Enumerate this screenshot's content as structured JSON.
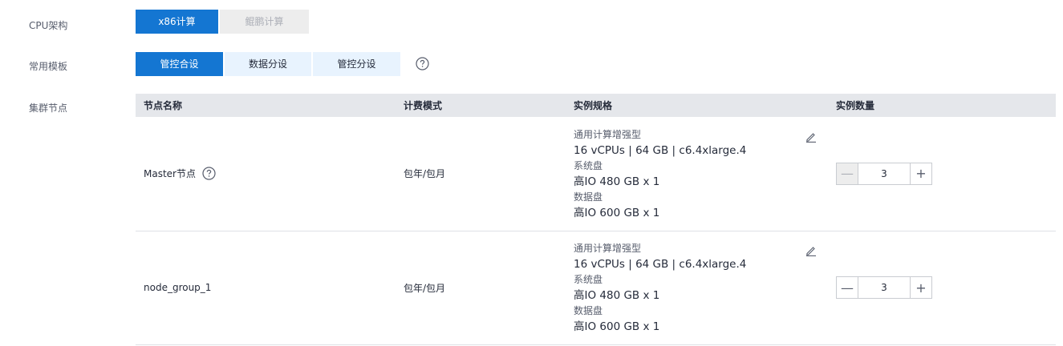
{
  "cpu_arch": {
    "label": "CPU架构",
    "options": [
      {
        "label": "x86计算",
        "state": "selected"
      },
      {
        "label": "鲲鹏计算",
        "state": "disabled"
      }
    ]
  },
  "template": {
    "label": "常用模板",
    "options": [
      {
        "label": "管控合设",
        "state": "selected"
      },
      {
        "label": "数据分设",
        "state": "normal"
      },
      {
        "label": "管控分设",
        "state": "normal"
      }
    ],
    "help_icon": "question-circle-icon"
  },
  "cluster_nodes": {
    "label": "集群节点",
    "columns": [
      "节点名称",
      "计费模式",
      "实例规格",
      "实例数量"
    ],
    "rows": [
      {
        "name": "Master节点",
        "has_help": true,
        "billing": "包年/包月",
        "spec_type": "通用计算增强型",
        "spec_detail": "16 vCPUs | 64 GB | c6.4xlarge.4",
        "sys_disk_label": "系统盘",
        "sys_disk": "高IO 480 GB x 1",
        "data_disk_label": "数据盘",
        "data_disk": "高IO 600 GB x 1",
        "count": "3"
      },
      {
        "name": "node_group_1",
        "has_help": false,
        "billing": "包年/包月",
        "spec_type": "通用计算增强型",
        "spec_detail": "16 vCPUs | 64 GB | c6.4xlarge.4",
        "sys_disk_label": "系统盘",
        "sys_disk": "高IO 480 GB x 1",
        "data_disk_label": "数据盘",
        "data_disk": "高IO 600 GB x 1",
        "count": "3"
      }
    ],
    "stepper_minus": "—",
    "stepper_plus": "+"
  },
  "colors": {
    "accent": "#1476d2",
    "light_accent": "#e8f3fe",
    "disabled_bg": "#ededed",
    "header_bg": "#e5e7eb"
  }
}
